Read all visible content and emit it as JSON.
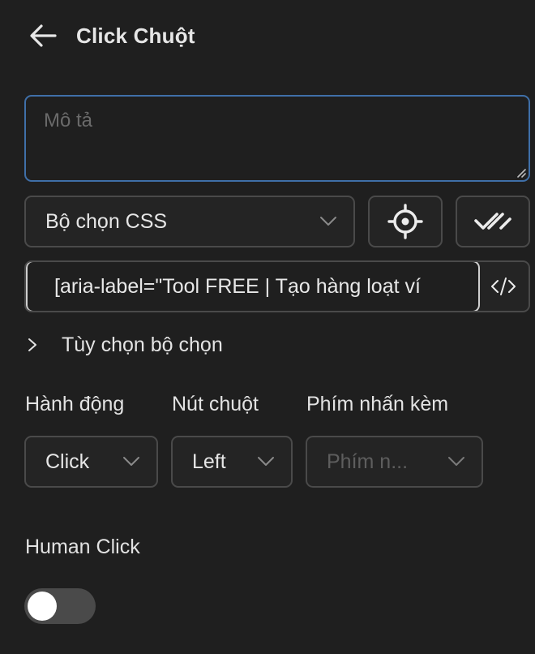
{
  "header": {
    "title": "Click Chuột",
    "back_icon": "arrow-left-icon"
  },
  "description": {
    "placeholder": "Mô tả",
    "value": ""
  },
  "selector_type": {
    "value": "Bộ chọn CSS",
    "icon": "chevron-down-icon"
  },
  "toolbar": {
    "pick_icon": "crosshair-icon",
    "verify_icon": "double-check-icon"
  },
  "selector": {
    "value": "[aria-label=\"Tool FREE | Tạo hàng loạt ví",
    "code_icon": "code-icon"
  },
  "options": {
    "label": "Tùy chọn bộ chọn",
    "expanded": false
  },
  "fields": {
    "action": {
      "label": "Hành động",
      "value": "Click"
    },
    "mouse_button": {
      "label": "Nút chuột",
      "value": "Left"
    },
    "modifier_keys": {
      "label": "Phím nhấn kèm",
      "placeholder": "Phím n..."
    }
  },
  "human_click": {
    "label": "Human Click",
    "enabled": false
  },
  "colors": {
    "background": "#1f1f1f",
    "focus_border": "#3f6fa8",
    "border": "#4a4a4a",
    "toggle_off": "#4a4a4a"
  }
}
